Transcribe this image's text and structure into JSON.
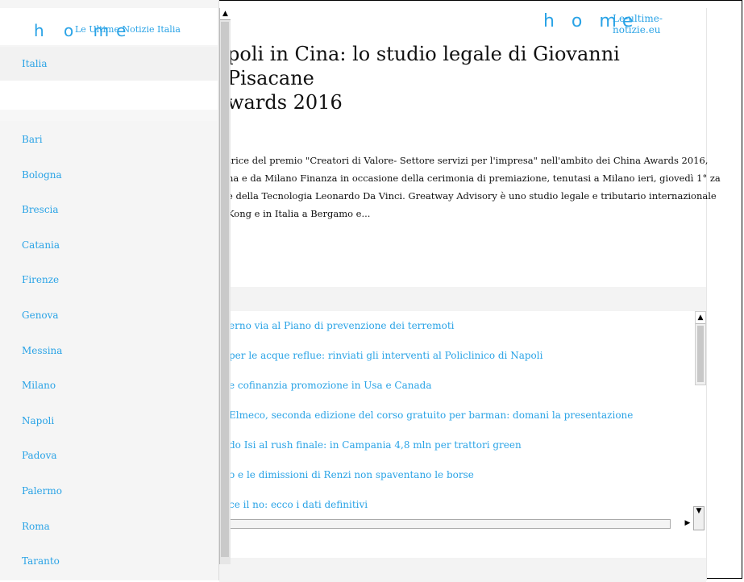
{
  "main": {
    "home_logo": "h o me",
    "site_link": "Le-ultime-notizie.eu",
    "article_title": "poli in Cina: lo studio legale di Giovanni Pisacane\nwards 2016",
    "article_text": "trice del premio \"Creatori di Valore- Settore servizi per l'impresa\" nell'ambito dei China Awards 2016, na e da Milano Finanza in occasione della cerimonia di premiazione, tenutasi a Milano ieri, giovedì 1° za e della Tecnologia Leonardo Da Vinci. Greatway Advisory è uno studio legale e tributario internazionale Kong e in Italia a Bergamo e...",
    "news": [
      "erno via al Piano di prevenzione dei terremoti",
      "per le acque reflue: rinviati gli interventi al Policlinico di Napoli",
      "e cofinanzia promozione in Usa e Canada",
      "Elmeco, seconda edizione del corso gratuito per barman: domani la presentazione",
      "do Isi al rush finale: in Campania 4,8 mln per trattori green",
      "o e le dimissioni di Renzi non spaventano le borse",
      "ce il no: ecco i dati definitivi"
    ]
  },
  "drawer": {
    "home_logo": "h o me",
    "site_name": "Le Ultime Notizie Italia",
    "top_item": "Italia",
    "cities": [
      "Bari",
      "Bologna",
      "Brescia",
      "Catania",
      "Firenze",
      "Genova",
      "Messina",
      "Milano",
      "Napoli",
      "Padova",
      "Palermo",
      "Roma",
      "Taranto"
    ]
  },
  "scroll": {
    "up": "▲",
    "down": "▼",
    "right": "▶"
  },
  "colors": {
    "accent": "#2aa3e6"
  }
}
